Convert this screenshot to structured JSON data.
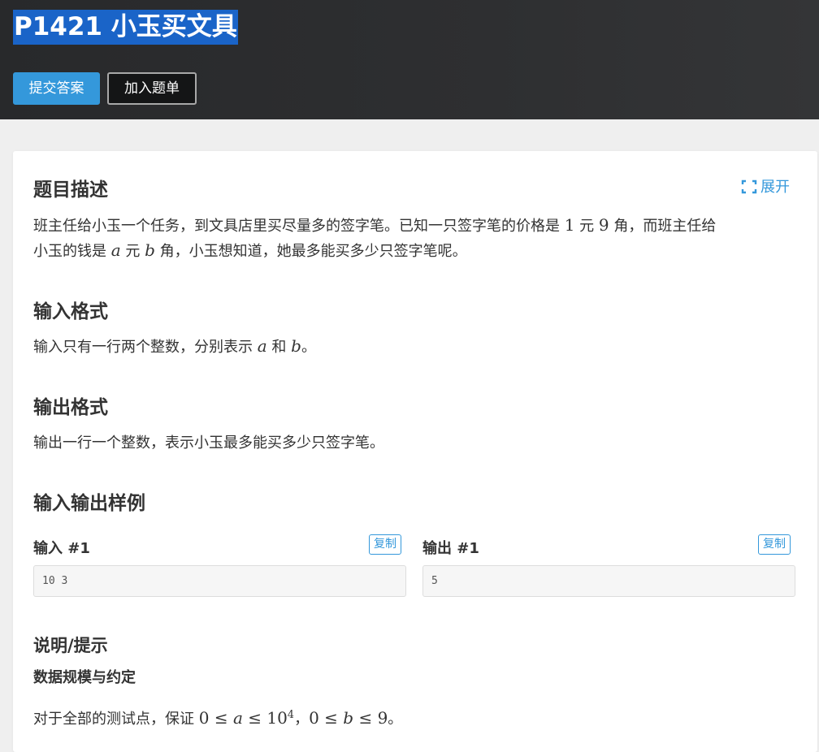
{
  "header": {
    "title": "P1421 小玉买文具",
    "submit_label": "提交答案",
    "add_list_label": "加入题单"
  },
  "description": {
    "heading": "题目描述",
    "expand_label": "展开",
    "line1_a": "班主任给小玉一个任务，到文具店里买尽量多的签字笔。已知一只签字笔的价格是 ",
    "num1": "1",
    "line1_b": " 元 ",
    "num2": "9",
    "line1_c": " 角，而班主任给",
    "line2_a": "小玉的钱是 ",
    "var_a": "a",
    "line2_b": " 元 ",
    "var_b": "b",
    "line2_c": " 角，小玉想知道，她最多能买多少只签字笔呢。"
  },
  "input_format": {
    "heading": "输入格式",
    "text_a": "输入只有一行两个整数，分别表示 ",
    "var_a": "a",
    "text_b": " 和 ",
    "var_b": "b",
    "text_c": "。"
  },
  "output_format": {
    "heading": "输出格式",
    "text": "输出一行一个整数，表示小玉最多能买多少只签字笔。"
  },
  "samples": {
    "heading": "输入输出样例",
    "input_label": "输入 #1",
    "output_label": "输出 #1",
    "copy_label": "复制",
    "input_value": "10 3",
    "output_value": "5"
  },
  "hint": {
    "heading": "说明/提示",
    "subheading": "数据规模与约定",
    "text_a": "对于全部的测试点，保证 ",
    "math1": "0 ≤ ",
    "var_a": "a",
    "math2": " ≤ 10",
    "exp": "4",
    "sep": "，",
    "math3": "0 ≤ ",
    "var_b": "b",
    "math4": " ≤ 9",
    "text_end": "。"
  },
  "colors": {
    "accent": "#3498db",
    "title_highlight": "#1a64c8",
    "header_bg": "#2e2f31"
  },
  "icons": {
    "expand": "expand-icon"
  }
}
